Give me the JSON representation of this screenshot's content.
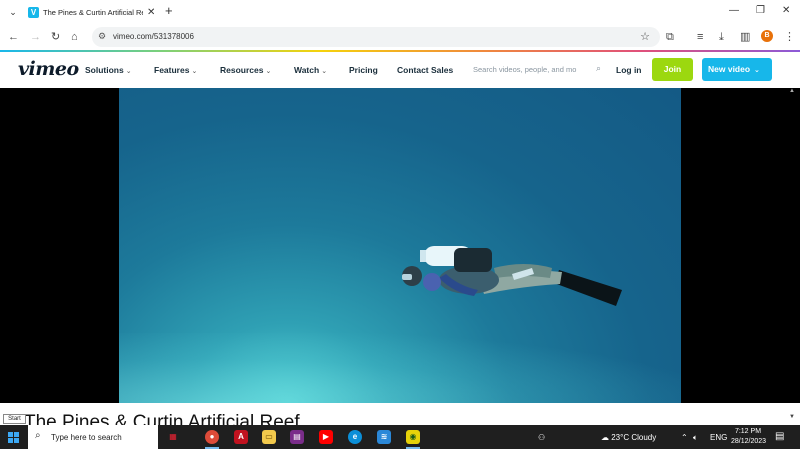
{
  "browser": {
    "tab_title": "The Pines & Curtin Artificial Re",
    "tab_favicon_letter": "V",
    "tab_list_icon": "chevron-down-icon",
    "url": "vimeo.com/531378006",
    "profile_initial": "B"
  },
  "vimeo": {
    "logo": "vimeo",
    "nav": [
      {
        "label": "Solutions",
        "dropdown": true
      },
      {
        "label": "Features",
        "dropdown": true
      },
      {
        "label": "Resources",
        "dropdown": true
      },
      {
        "label": "Watch",
        "dropdown": true
      },
      {
        "label": "Pricing",
        "dropdown": false
      },
      {
        "label": "Contact Sales",
        "dropdown": false
      }
    ],
    "search_placeholder": "Search videos, people, and mo",
    "login_label": "Log in",
    "join_label": "Join",
    "new_video_label": "New video",
    "colors": {
      "join": "#9cd80f",
      "new_video": "#17b7ea",
      "text": "#1a2e3b"
    }
  },
  "video": {
    "title": "The Pines & Curtin Artificial Reef"
  },
  "tooltip": {
    "start": "Start"
  },
  "taskbar": {
    "search_placeholder": "Type here to search",
    "weather": "23°C  Cloudy",
    "language": "ENG",
    "time": "7:12 PM",
    "date": "28/12/2023"
  }
}
